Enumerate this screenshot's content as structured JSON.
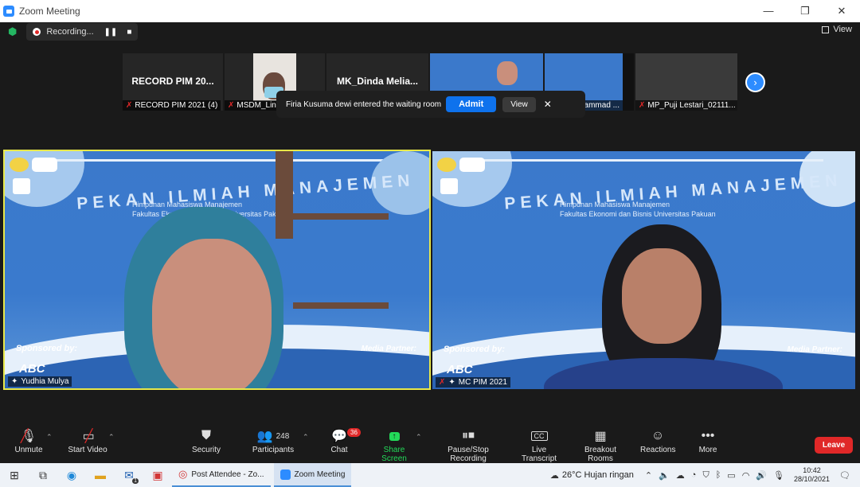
{
  "window": {
    "title": "Zoom Meeting",
    "minimize": "—",
    "restore": "❐",
    "close": "✕"
  },
  "topbar": {
    "recording_label": "Recording...",
    "view_label": "View"
  },
  "strip": {
    "thumbs": [
      {
        "big": "RECORD PIM 20...",
        "name": "RECORD PIM 2021 (4)"
      },
      {
        "big": "",
        "name": "MSDM_Lin..."
      },
      {
        "big": "MK_Dinda  Melia...",
        "name": ""
      },
      {
        "big": "",
        "name": ""
      },
      {
        "big": "",
        "name": "uhammad ..."
      },
      {
        "big": "",
        "name": "MP_Puji Lestari_02111..."
      }
    ],
    "next_icon": "chevron-right-icon"
  },
  "notification": {
    "text": "Firia Kusuma dewi entered the waiting room",
    "admit": "Admit",
    "view": "View",
    "close": "✕"
  },
  "videos": [
    {
      "headline": "PEKAN ILMIAH MANAJEMEN",
      "sub1": "Himpunan Mahasiswa Manajemen",
      "sub2": "Fakultas Ekonomi dan Bisnis Universitas Pakuan",
      "sponsor": "Sponsored by:",
      "abc": "ABC",
      "media": "Media Partner:",
      "name": "Yudhia Mulya"
    },
    {
      "headline": "PEKAN ILMIAH MANAJEMEN",
      "sub1": "Himpunan Mahasiswa Manajemen",
      "sub2": "Fakultas Ekonomi dan Bisnis Universitas Pakuan",
      "sponsor": "Sponsored by:",
      "abc": "ABC",
      "media": "Media Partner:",
      "name": "MC PIM 2021"
    }
  ],
  "toolbar": {
    "unmute": "Unmute",
    "start_video": "Start Video",
    "security": "Security",
    "participants": "Participants",
    "participants_count": "248",
    "chat": "Chat",
    "chat_badge": "36",
    "share_screen": "Share Screen",
    "pause_stop_recording": "Pause/Stop Recording",
    "live_transcript": "Live Transcript",
    "breakout_rooms": "Breakout Rooms",
    "reactions": "Reactions",
    "more": "More",
    "leave": "Leave",
    "accent": "#23d959",
    "leave_color": "#e02828"
  },
  "taskbar": {
    "tasks": [
      {
        "label": "Post Attendee - Zo...",
        "icon": "chrome-icon"
      },
      {
        "label": "Zoom Meeting",
        "icon": "zoom-icon"
      }
    ],
    "weather": "26°C  Hujan ringan",
    "time": "10:42",
    "date": "28/10/2021",
    "mail_badge": "1"
  }
}
